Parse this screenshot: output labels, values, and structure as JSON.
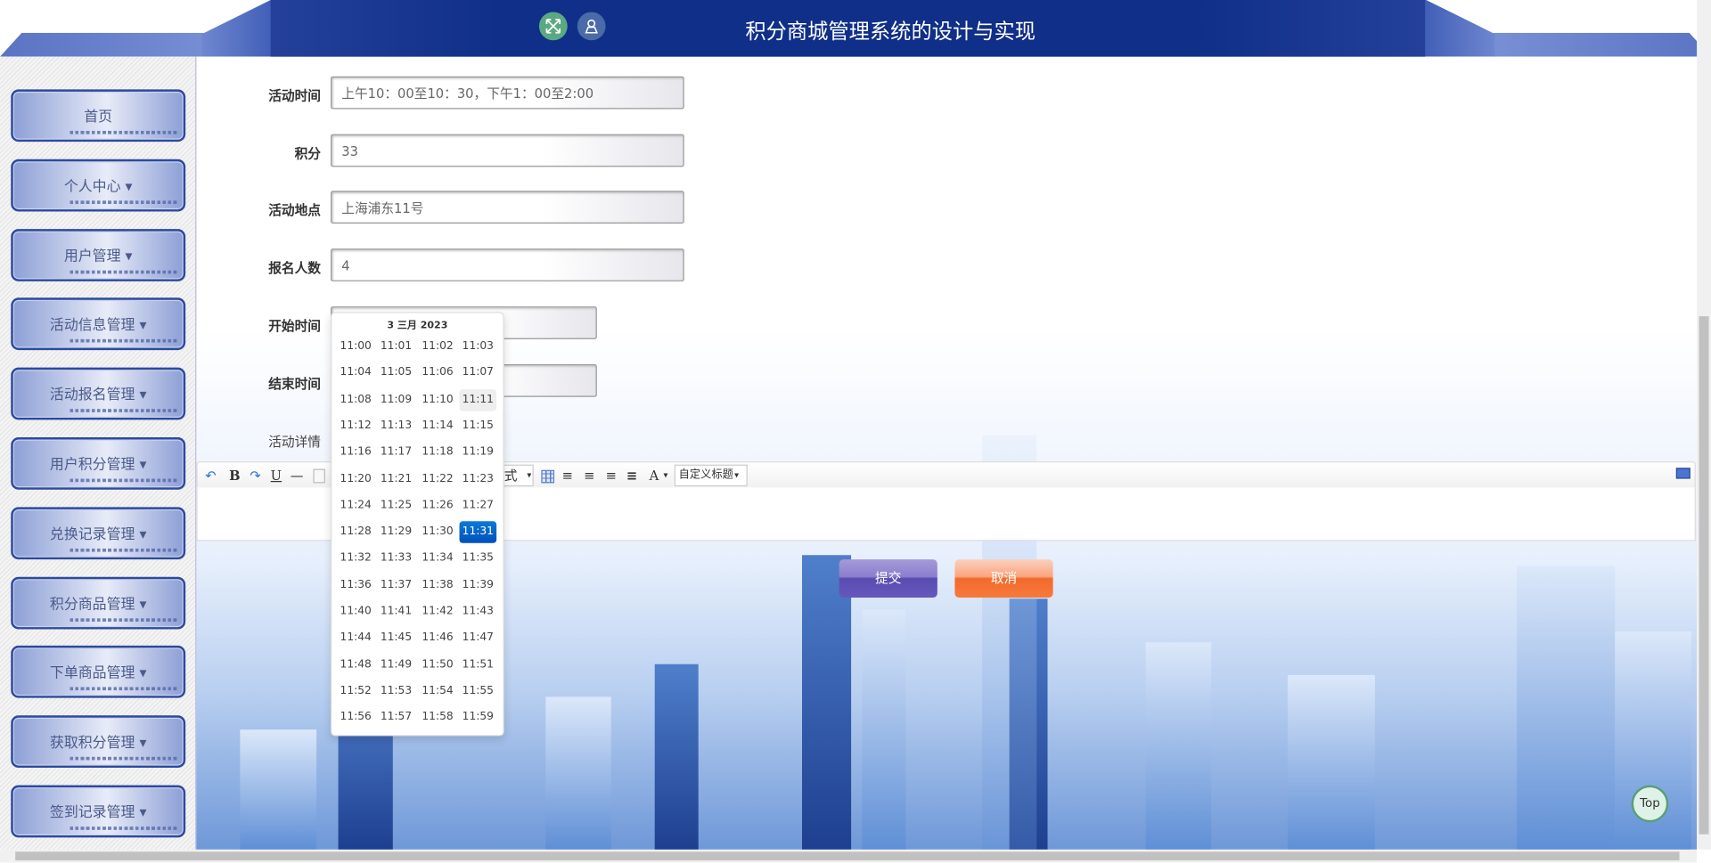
{
  "header": {
    "title": "积分商城管理系统的设计与实现",
    "icons": [
      "fullscreen-icon",
      "user-icon"
    ]
  },
  "sidebar": {
    "items": [
      {
        "label": "首页"
      },
      {
        "label": "个人中心 ▾"
      },
      {
        "label": "用户管理 ▾"
      },
      {
        "label": "活动信息管理 ▾"
      },
      {
        "label": "活动报名管理 ▾"
      },
      {
        "label": "用户积分管理 ▾"
      },
      {
        "label": "兑换记录管理 ▾"
      },
      {
        "label": "积分商品管理 ▾"
      },
      {
        "label": "下单商品管理 ▾"
      },
      {
        "label": "获取积分管理 ▾"
      },
      {
        "label": "签到记录管理 ▾"
      }
    ]
  },
  "form": {
    "activity_time": {
      "label": "活动时间",
      "value": "上午10：00至10：30，下午1：00至2:00"
    },
    "points": {
      "label": "积分",
      "value": "33"
    },
    "location": {
      "label": "活动地点",
      "value": "上海浦东11号"
    },
    "signup_count": {
      "label": "报名人数",
      "value": "4"
    },
    "start_time": {
      "label": "开始时间",
      "value": ""
    },
    "end_time": {
      "label": "结束时间",
      "value": ""
    },
    "details": {
      "label": "活动详情"
    }
  },
  "editor": {
    "toolbar": {
      "bold": "B",
      "underline": "U",
      "style_select": "式",
      "font_color": "A",
      "heading_select": "自定义标题"
    }
  },
  "datepicker": {
    "date": "3 三月 2023",
    "selected": "11:31",
    "hovered": "11:11",
    "times": [
      "11:00",
      "11:01",
      "11:02",
      "11:03",
      "11:04",
      "11:05",
      "11:06",
      "11:07",
      "11:08",
      "11:09",
      "11:10",
      "11:11",
      "11:12",
      "11:13",
      "11:14",
      "11:15",
      "11:16",
      "11:17",
      "11:18",
      "11:19",
      "11:20",
      "11:21",
      "11:22",
      "11:23",
      "11:24",
      "11:25",
      "11:26",
      "11:27",
      "11:28",
      "11:29",
      "11:30",
      "11:31",
      "11:32",
      "11:33",
      "11:34",
      "11:35",
      "11:36",
      "11:37",
      "11:38",
      "11:39",
      "11:40",
      "11:41",
      "11:42",
      "11:43",
      "11:44",
      "11:45",
      "11:46",
      "11:47",
      "11:48",
      "11:49",
      "11:50",
      "11:51",
      "11:52",
      "11:53",
      "11:54",
      "11:55",
      "11:56",
      "11:57",
      "11:58",
      "11:59"
    ]
  },
  "actions": {
    "submit": "提交",
    "cancel": "取消"
  },
  "back_to_top": "Top",
  "colors": {
    "header": "#0f2f88",
    "selected": "#0a6ad0",
    "submit": "#6558bb",
    "cancel": "#f26a2a"
  }
}
